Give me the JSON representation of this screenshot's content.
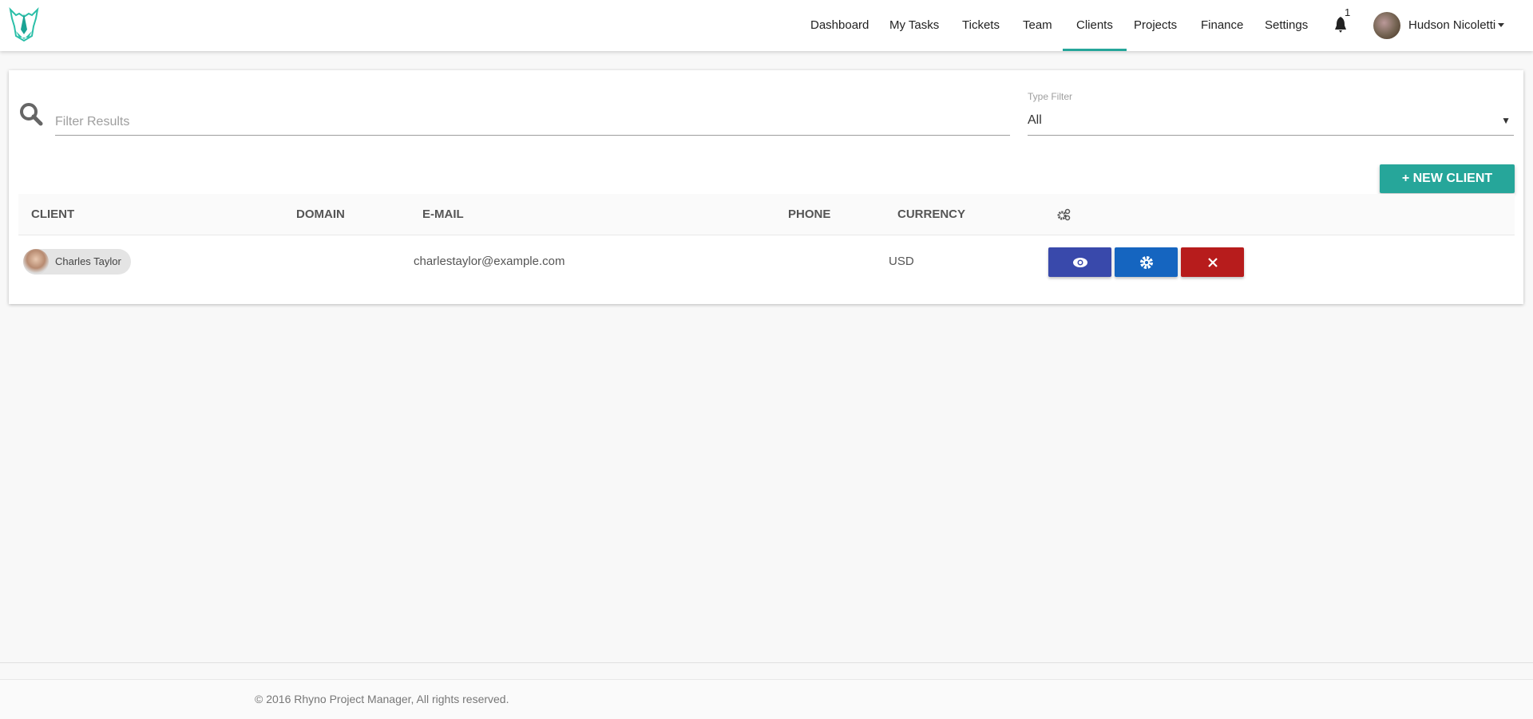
{
  "nav": {
    "items": [
      "Dashboard",
      "My Tasks",
      "Tickets",
      "Team",
      "Clients",
      "Projects",
      "Finance",
      "Settings"
    ],
    "active": "Clients",
    "notifications": "1",
    "user": "Hudson Nicoletti"
  },
  "filters": {
    "search_placeholder": "Filter Results",
    "type_label": "Type Filter",
    "type_value": "All"
  },
  "new_client_label": "+ NEW CLIENT",
  "table": {
    "headers": [
      "CLIENT",
      "DOMAIN",
      "E-MAIL",
      "PHONE",
      "CURRENCY"
    ],
    "rows": [
      {
        "client": "Charles Taylor",
        "domain": "",
        "email": "charlestaylor@example.com",
        "phone": "",
        "currency": "USD"
      }
    ]
  },
  "footer": "© 2016 Rhyno Project Manager, All rights reserved.",
  "colors": {
    "accent": "#26a69a",
    "view": "#3949ab",
    "edit": "#1565c0",
    "delete": "#b71c1c"
  }
}
